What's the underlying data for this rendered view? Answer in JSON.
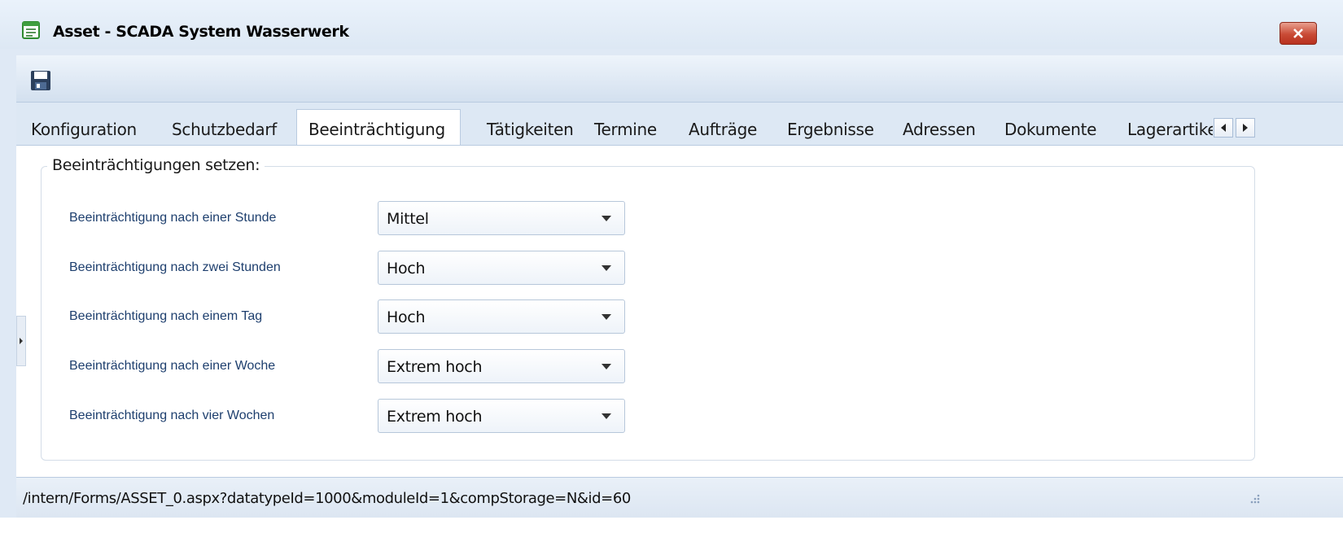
{
  "window": {
    "title": "Asset - SCADA System Wasserwerk"
  },
  "toolbar": {
    "save_icon": "floppy-disk-icon"
  },
  "tabs": [
    {
      "label": "Konfiguration",
      "active": false
    },
    {
      "label": "Schutzbedarf",
      "active": false
    },
    {
      "label": "Beeinträchtigung",
      "active": true
    },
    {
      "label": "Tätigkeiten",
      "active": false
    },
    {
      "label": "Termine",
      "active": false
    },
    {
      "label": "Aufträge",
      "active": false
    },
    {
      "label": "Ergebnisse",
      "active": false
    },
    {
      "label": "Adressen",
      "active": false
    },
    {
      "label": "Dokumente",
      "active": false
    },
    {
      "label": "Lagerartikel",
      "active": false
    }
  ],
  "group": {
    "legend": "Beeinträchtigungen setzen:",
    "rows": [
      {
        "label": "Beeinträchtigung nach einer Stunde",
        "value": "Mittel"
      },
      {
        "label": "Beeinträchtigung nach zwei Stunden",
        "value": "Hoch"
      },
      {
        "label": "Beeinträchtigung nach einem Tag",
        "value": "Hoch"
      },
      {
        "label": "Beeinträchtigung nach einer Woche",
        "value": "Extrem hoch"
      },
      {
        "label": "Beeinträchtigung nach vier Wochen",
        "value": "Extrem hoch"
      }
    ]
  },
  "status": {
    "url": "/intern/Forms/ASSET_0.aspx?datatypeId=1000&moduleId=1&compStorage=N&id=60"
  },
  "colors": {
    "label_text": "#1e3f6e",
    "close_button": "#c94a35"
  }
}
